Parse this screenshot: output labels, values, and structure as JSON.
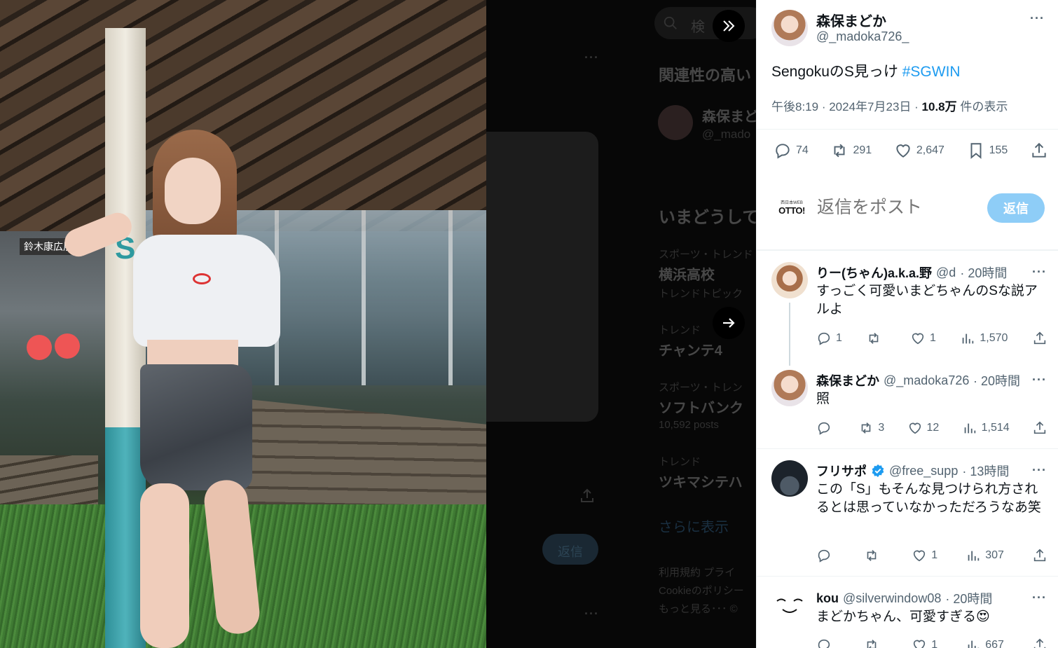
{
  "tweet": {
    "author_name": "森保まどか",
    "author_handle": "@_madoka726_",
    "text_main": "SengokuのS見っけ ",
    "hashtag": "#SGWIN",
    "time": "午後8:19",
    "date": "2024年7月23日",
    "views_value": "10.8万",
    "views_label": " 件の表示",
    "more": "···",
    "stats": {
      "replies": "74",
      "retweets": "291",
      "likes": "2,647",
      "bookmarks": "155"
    }
  },
  "composer": {
    "avatar_text": "OTTO!",
    "avatar_small": "西日本WEB",
    "placeholder": "返信をポスト",
    "reply_button": "返信"
  },
  "replies": [
    {
      "name": "りー(ちゃん)a.k.a.野",
      "handle": "@d",
      "time": "· 20時間",
      "more": "···",
      "text": "すっごく可愛いまどちゃんのSな説アルよ",
      "replies": "1",
      "retweets": "",
      "likes": "1",
      "views": "1,570"
    },
    {
      "name": "森保まどか",
      "handle": "@_madoka726",
      "time": "· 20時間",
      "more": "···",
      "text": "照",
      "replies": "",
      "retweets": "3",
      "likes": "12",
      "views": "1,514"
    },
    {
      "name": "フリサポ",
      "handle": "@free_supp",
      "time": "· 13時間",
      "more": "···",
      "text": "この「S」もそんな見つけられ方されるとは思っていなかっただろうなあ笑",
      "replies": "",
      "retweets": "",
      "likes": "1",
      "views": "307"
    },
    {
      "name": "kou",
      "handle": "@silverwindow08",
      "time": "· 20時間",
      "more": "···",
      "text": "まどかちゃん、可愛すぎる😍",
      "replies": "",
      "retweets": "",
      "likes": "1",
      "views": "667"
    }
  ],
  "background": {
    "heading1": "関連性の高い",
    "user_name": "森保まど",
    "user_handle": "@_mado",
    "heading2": "いまどうして",
    "trends": [
      {
        "category": "スポーツ・トレンド",
        "title": "横浜高校",
        "sub": "トレンドトピック"
      },
      {
        "category": "トレンド",
        "title": "チャンテ4",
        "sub": ""
      },
      {
        "category": "スポーツ・トレン",
        "title": "ソフトバンク",
        "sub": "10,592 posts"
      },
      {
        "category": "トレンド",
        "title": "ツキマシテハ",
        "sub": ""
      }
    ],
    "show_more": "さらに表示",
    "footer1": "利用規約  プライ",
    "footer2": "Cookieのポリシー",
    "footer3": "もっと見る･･･  ©",
    "reply_dim": "返信",
    "search_text": "検"
  },
  "photo": {
    "pillar_letter": "S",
    "sign": "鈴木康広展"
  },
  "colors": {
    "accent": "#1d9bf0",
    "reply_button_bg": "#8ecdf7",
    "verified": "#1d9bf0"
  }
}
